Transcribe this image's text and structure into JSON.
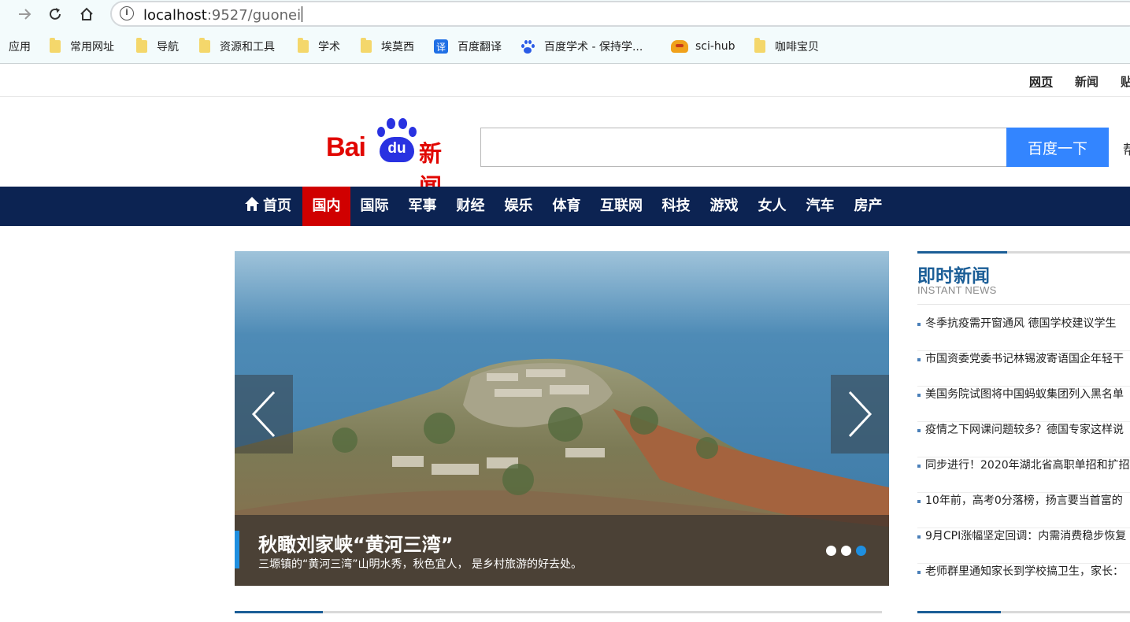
{
  "browser": {
    "url_host": "localhost",
    "url_path": ":9527/guonei",
    "bookmarks": [
      {
        "label": "应用",
        "icon": "apps-icon"
      },
      {
        "label": "常用网址",
        "icon": "folder-icon"
      },
      {
        "label": "导航",
        "icon": "folder-icon"
      },
      {
        "label": "资源和工具",
        "icon": "folder-icon"
      },
      {
        "label": "学术",
        "icon": "folder-icon"
      },
      {
        "label": "埃莫西",
        "icon": "folder-icon"
      },
      {
        "label": "百度翻译",
        "icon": "translate-icon",
        "badge": "译"
      },
      {
        "label": "百度学术 - 保持学...",
        "icon": "baidu-paw-icon"
      },
      {
        "label": "sci-hub",
        "icon": "scihub-icon"
      },
      {
        "label": "咖啡宝贝",
        "icon": "folder-icon"
      }
    ]
  },
  "topbar": {
    "links": [
      "网页",
      "新闻",
      "贴吧"
    ]
  },
  "header": {
    "logo_bai": "Bai",
    "logo_du": "du",
    "logo_news": "新闻",
    "search_placeholder": "",
    "search_button": "百度一下",
    "help_link": "帮助"
  },
  "channels": {
    "active": "国内",
    "items": [
      "首页",
      "国内",
      "国际",
      "军事",
      "财经",
      "娱乐",
      "体育",
      "互联网",
      "科技",
      "游戏",
      "女人",
      "汽车",
      "房产"
    ]
  },
  "slider": {
    "title": "秋瞰刘家峡“黄河三湾”",
    "subtitle": "三塬镇的“黄河三湾”山明水秀，秋色宜人， 是乡村旅游的好去处。",
    "slide_count": 3,
    "active_slide": 3
  },
  "instant_news": {
    "title": "即时新闻",
    "subtitle": "INSTANT NEWS",
    "items": [
      "冬季抗疫需开窗通风 德国学校建议学生",
      "市国资委党委书记林锡波寄语国企年轻干",
      "美国务院试图将中国蚂蚁集团列入黑名单",
      "疫情之下网课问题较多？德国专家这样说",
      "同步进行！2020年湖北省高职单招和扩招",
      "10年前，高考0分落榜，扬言要当首富的",
      "9月CPI涨幅坚定回调：内需消费稳步恢复",
      "老师群里通知家长到学校搞卫生，家长："
    ]
  },
  "colors": {
    "channel_bar": "#0c2352",
    "channel_active": "#d00000",
    "search_button": "#3385ff",
    "logo_red": "#e10601",
    "logo_blue": "#2932e1",
    "section_blue": "#1b5e97"
  }
}
